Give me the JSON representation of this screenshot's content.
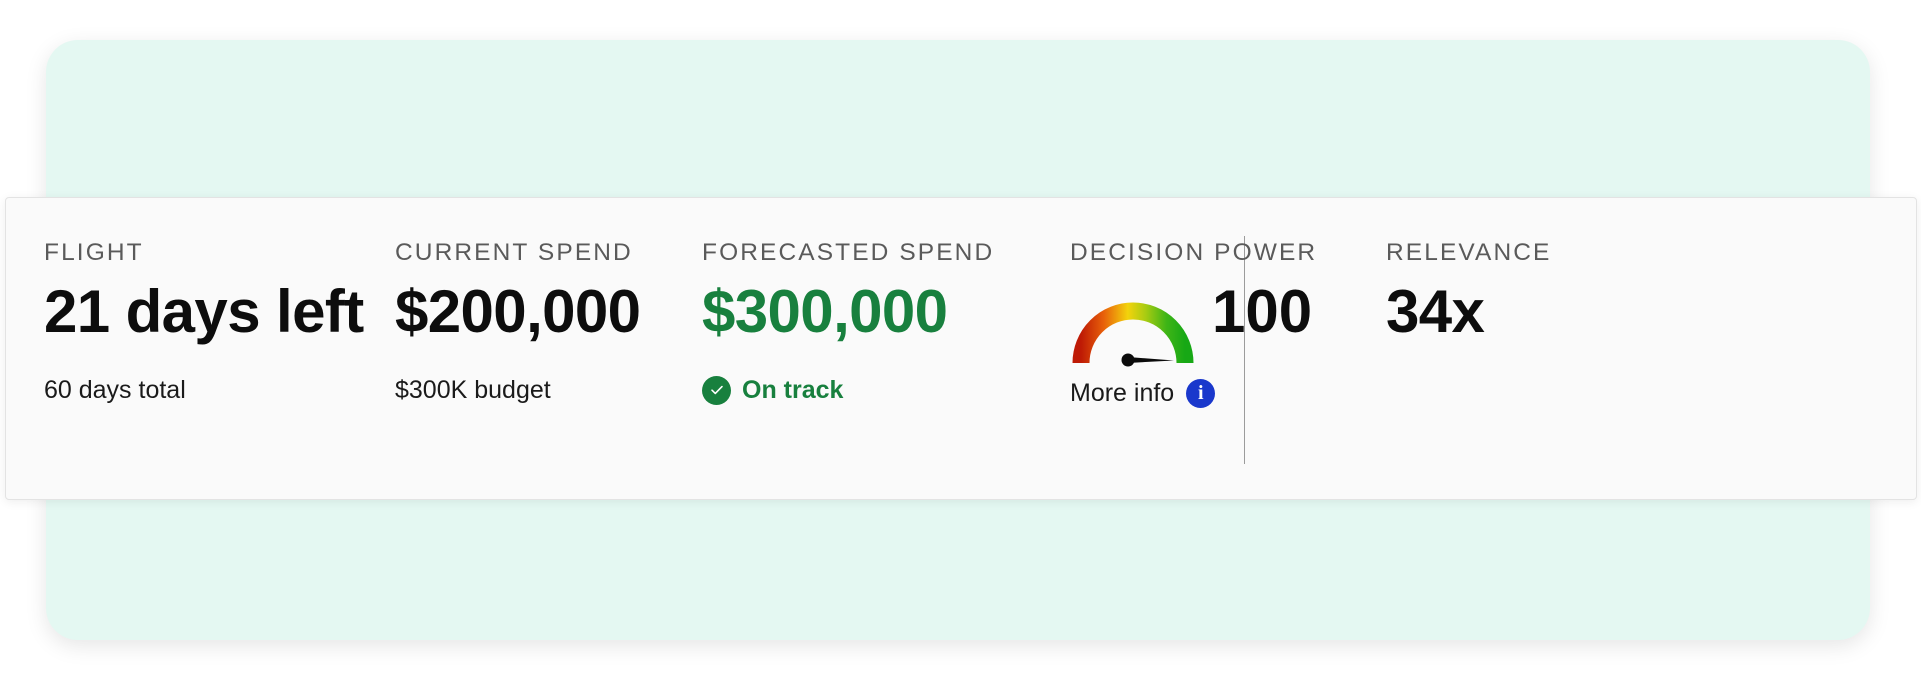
{
  "card": {
    "background_color": "#E4F8F2",
    "panel_background_color": "#FAFAFA"
  },
  "colors": {
    "accent_green": "#18803E",
    "info_blue": "#1A38CC",
    "label_gray": "#5A5A5A",
    "value_black": "#0D0D0D"
  },
  "metrics": [
    {
      "label": "FLIGHT",
      "value": "21 days left",
      "sub": "60 days total"
    },
    {
      "label": "CURRENT SPEND",
      "value": "$200,000",
      "sub": "$300K budget"
    },
    {
      "label": "FORECASTED SPEND",
      "value": "$300,000",
      "sub": "On track",
      "status_icon": "check-circle-icon"
    },
    {
      "label": "DECISION POWER",
      "value": "100",
      "sub": "More info",
      "gauge_icon": "gauge-icon",
      "info_icon": "info-icon"
    },
    {
      "label": "RELEVANCE",
      "value": "34x",
      "sub": ""
    }
  ],
  "chart_data": {
    "type": "gauge",
    "title": "DECISION POWER",
    "value": 100,
    "min": 0,
    "max": 100,
    "needle_angle_deg": 180,
    "gradient_stops": [
      "#C01A05",
      "#E8610A",
      "#F2C20B",
      "#8FC413",
      "#17A815"
    ],
    "legend": "none",
    "grid": false
  }
}
